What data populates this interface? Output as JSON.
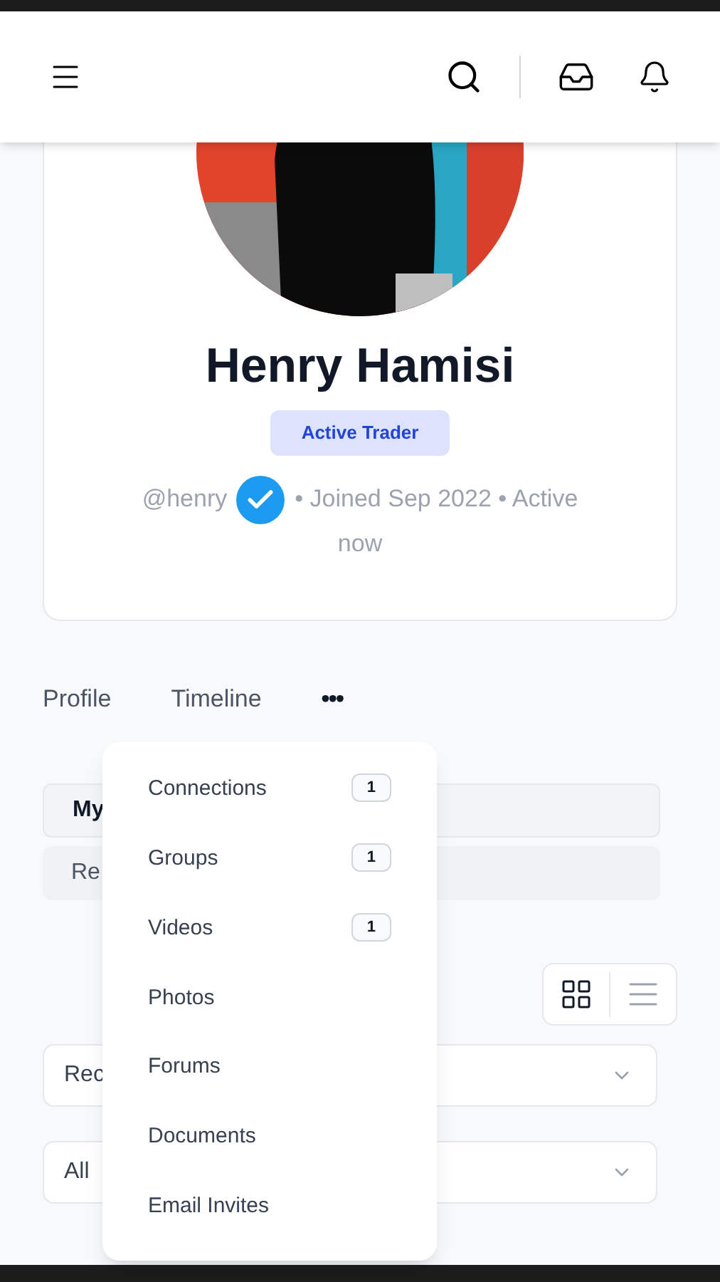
{
  "profile": {
    "name": "Henry Hamisi",
    "badge": "Active Trader",
    "handle": "@henry",
    "verified": true,
    "meta": "• Joined Sep 2022 • Active now"
  },
  "tabs": [
    {
      "label": "Profile"
    },
    {
      "label": "Timeline"
    },
    {
      "label": "•••"
    }
  ],
  "subnav": {
    "tab_label": "My",
    "field_text": "Re"
  },
  "view_toggle": [
    {
      "kind": "grid",
      "selected": true
    },
    {
      "kind": "list",
      "selected": false
    }
  ],
  "selects": [
    {
      "value": "Rec"
    },
    {
      "value": "All"
    }
  ],
  "more_menu": [
    {
      "label": "Connections",
      "count": "1"
    },
    {
      "label": "Groups",
      "count": "1"
    },
    {
      "label": "Videos",
      "count": "1"
    },
    {
      "label": "Photos"
    },
    {
      "label": "Forums"
    },
    {
      "label": "Documents"
    },
    {
      "label": "Email Invites"
    }
  ]
}
